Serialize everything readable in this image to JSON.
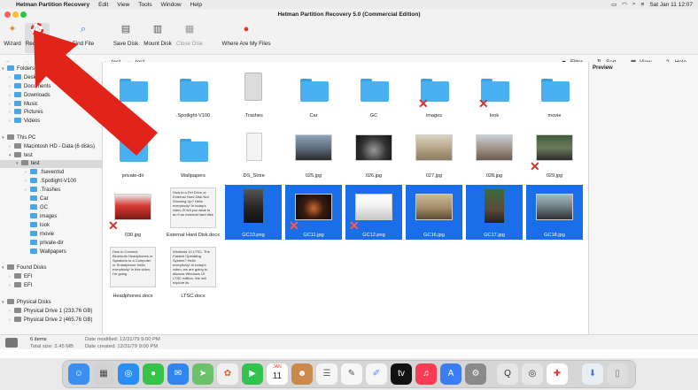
{
  "menubar": {
    "app": "Hetman Partition Recovery",
    "items": [
      "Edit",
      "View",
      "Tools",
      "Window",
      "Help"
    ],
    "datetime": "Sat Jan 11  12:07"
  },
  "window": {
    "title": "Hetman Partition Recovery 5.0 (Commercial Edition)"
  },
  "toolbar": {
    "wizard": "Wizard",
    "recovery": "Recovery",
    "find_file": "Find File",
    "save_disk": "Save Disk",
    "mount_disk": "Mount Disk",
    "close_disk": "Close Disk",
    "where_files": "Where Are My Files"
  },
  "navbar": {
    "crumb1": "test",
    "crumb2": "test",
    "filter": "Filter",
    "sort": "Sort",
    "view": "View",
    "help": "Help"
  },
  "sidebar": {
    "folders_header": "Folders",
    "folders": [
      "Desktop",
      "Documents",
      "Downloads",
      "Music",
      "Pictures",
      "Videos"
    ],
    "thispc_header": "This PC",
    "disks": [
      "Macintosh HD - Data (6 disks)",
      "test"
    ],
    "test_sub": "test",
    "test_children": [
      ".fseventsd",
      ".Spotlight-V100",
      ".Trashes",
      "Car",
      "GC",
      "images",
      "look",
      "movie",
      "private-dir",
      "Wallpapers"
    ],
    "found_header": "Found Disks",
    "found": [
      "EFI",
      "EFI"
    ],
    "physical_header": "Physical Disks",
    "physical": [
      "Physical Drive 1 (233.76 GB)",
      "Physical Drive 2 (465.76 GB)"
    ]
  },
  "files": {
    "row1": [
      ".Spotlight-V100",
      ".Trashes",
      "Car",
      "GC",
      "images",
      "look",
      "movie"
    ],
    "row2": [
      "private-dir",
      "Wallpapers",
      ".DS_Store",
      "025.jpg",
      "026.jpg",
      "027.jpg",
      "028.jpg",
      "029.jpg"
    ],
    "row3": [
      "030.jpg",
      "External Hard Disk.docx",
      "GC10.png",
      "GC11.jpg",
      "GC12.png",
      "GC16.jpg",
      "GC17.jpg",
      "GC18.jpg"
    ],
    "row4": [
      "Headphones.docx",
      "LTSC.docx"
    ],
    "doc1_text": "How to a Fet Drive or External Hard Disk Not Showing Up? Hello everybody! In today's video I'll tell you what to do if an external hard disk",
    "doc2_text": "How to Connect Bluetooth Headphones or Speakers to a Computer or Smartphone Hello everybody! In this video, I'm going",
    "doc3_text": "Windows 10 LTSC. The Fastest Operating System? Hello everybody! In today's video, we are going to discuss Windows 10 LTSC edition. We will explore its"
  },
  "preview": {
    "title": "Preview"
  },
  "status": {
    "items": "6 items",
    "total_size": "Total size: 3.45 MB",
    "modified": "Date modified: 12/31/79 9:00 PM",
    "created": "Date created: 12/31/79 9:00 PM"
  },
  "dock": {
    "calendar_month": "JAN",
    "calendar_day": "11"
  },
  "colors": {
    "selection": "#1a6ee8",
    "folder": "#49b1f2",
    "arrow": "#e2231a"
  }
}
